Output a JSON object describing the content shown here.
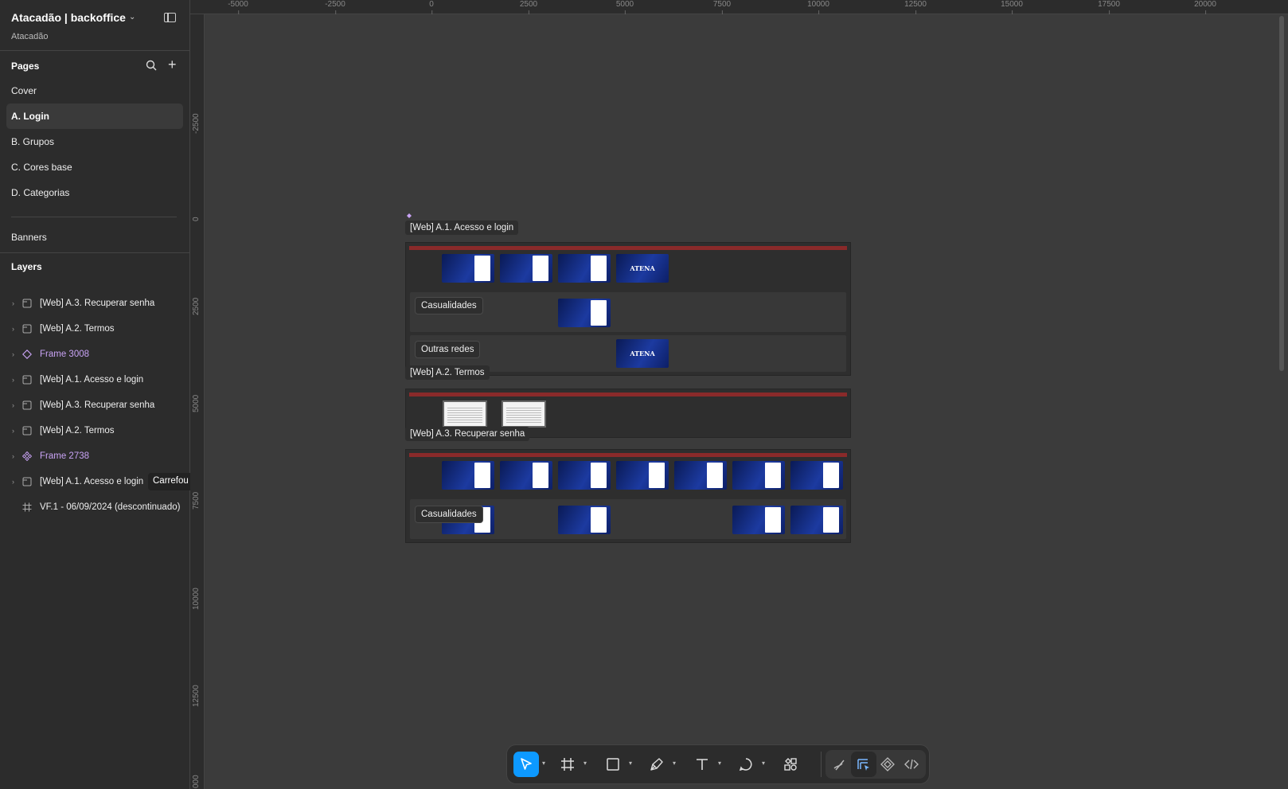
{
  "file": {
    "title": "Atacadão | backoffice",
    "subtitle": "Atacadão"
  },
  "pages": {
    "title": "Pages",
    "items": [
      {
        "label": "Cover"
      },
      {
        "label": "A. Login",
        "active": true
      },
      {
        "label": "B. Grupos"
      },
      {
        "label": "C. Cores base"
      },
      {
        "label": "D. Categorias"
      }
    ],
    "extra": "Banners"
  },
  "layers": {
    "title": "Layers",
    "items": [
      {
        "label": "[Web] A.3. Recuperar senha",
        "icon": "section-icon"
      },
      {
        "label": "[Web] A.2. Termos",
        "icon": "section-icon"
      },
      {
        "label": "Frame 3008",
        "icon": "component-instance-icon"
      },
      {
        "label": "[Web] A.1. Acesso e login",
        "icon": "section-icon"
      },
      {
        "label": "[Web] A.3. Recuperar senha",
        "icon": "section-icon"
      },
      {
        "label": "[Web] A.2. Termos",
        "icon": "section-icon"
      },
      {
        "label": "Frame 2738",
        "icon": "component-set-icon"
      },
      {
        "label": "[Web] A.1. Acesso e login",
        "icon": "section-icon",
        "tag": "Carrefou"
      },
      {
        "label": "VF.1 - 06/09/2024 (descontinuado)",
        "icon": "frame-icon"
      }
    ]
  },
  "ruler": {
    "top": [
      "-5000",
      "-2500",
      "0",
      "2500",
      "5000",
      "7500",
      "10000",
      "12500",
      "15000",
      "17500",
      "20000"
    ],
    "left": [
      "-2500",
      "0",
      "2500",
      "5000",
      "7500",
      "10000",
      "12500",
      "000"
    ]
  },
  "canvas": {
    "section1": {
      "label": "[Web] A.1. Acesso e login",
      "row1": "Casualidades",
      "row2": "Outras redes",
      "logo": "ATENA"
    },
    "section2": {
      "label": "[Web] A.2. Termos"
    },
    "section3": {
      "label": "[Web] A.3. Recuperar senha",
      "row1": "Casualidades"
    }
  },
  "toolbar": {
    "tools": [
      "move-tool",
      "frame-tool",
      "rectangle-tool",
      "pen-tool",
      "text-tool",
      "comment-tool",
      "actions-tool"
    ],
    "modes": [
      "draw-mode",
      "design-mode",
      "prototype-mode",
      "dev-mode"
    ],
    "accent": "#0d99ff"
  }
}
